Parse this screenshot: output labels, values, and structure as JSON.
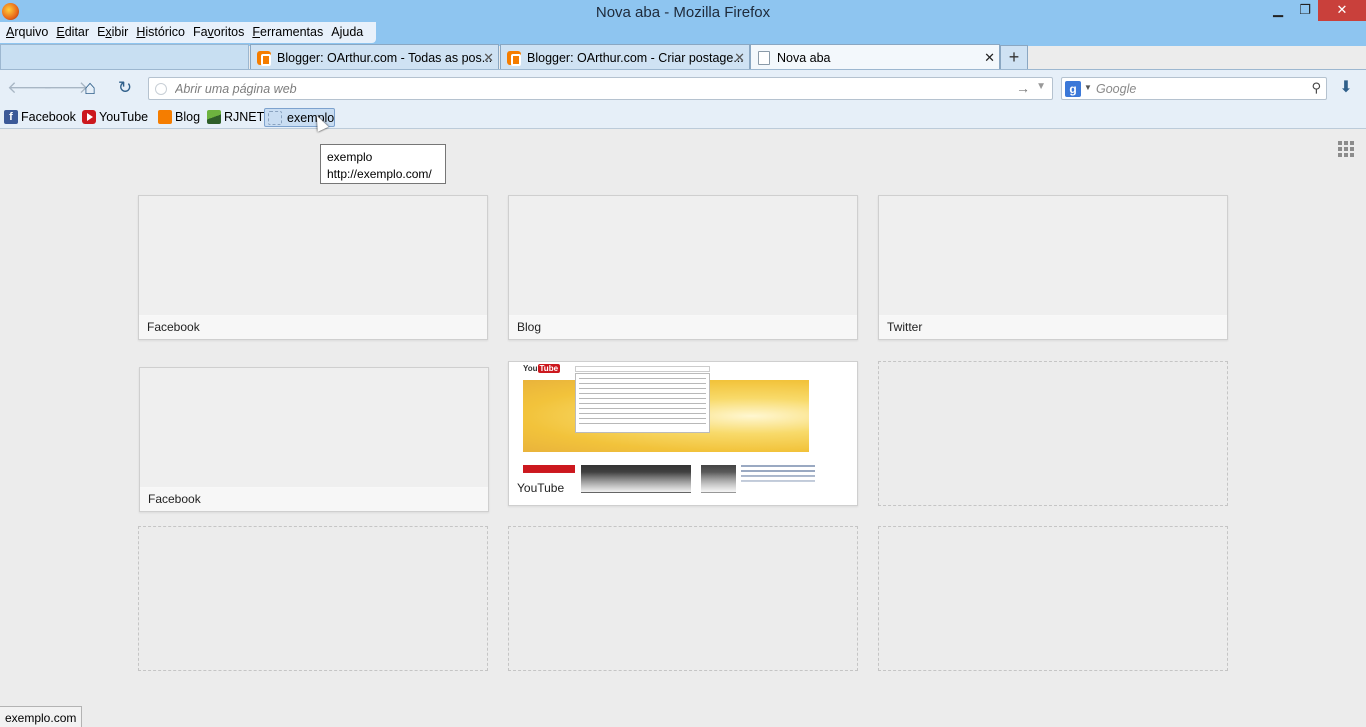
{
  "window": {
    "title": "Nova aba - Mozilla Firefox",
    "controls": {
      "minimize": "▁",
      "restore": "❐",
      "close": "✕"
    }
  },
  "menu": [
    {
      "label": "Arquivo",
      "accel": "A",
      "rest": "rquivo"
    },
    {
      "label": "Editar",
      "accel": "E",
      "rest": "ditar"
    },
    {
      "label": "Exibir",
      "accel": "x",
      "pre": "E",
      "rest": "ibir"
    },
    {
      "label": "Histórico",
      "accel": "H",
      "rest": "istórico"
    },
    {
      "label": "Favoritos",
      "accel": "v",
      "pre": "Fa",
      "rest": "oritos"
    },
    {
      "label": "Ferramentas",
      "accel": "F",
      "rest": "erramentas"
    },
    {
      "label": "Ajuda",
      "accel": "j",
      "pre": "A",
      "rest": "uda"
    }
  ],
  "tabs": [
    {
      "label": "Blogger: OArthur.com - Todas as pos...",
      "icon": "blogger-icon",
      "active": false
    },
    {
      "label": "Blogger: OArthur.com - Criar postage...",
      "icon": "blogger-icon",
      "active": false
    },
    {
      "label": "Nova aba",
      "icon": "blank-page-icon",
      "active": true
    }
  ],
  "tab_close_glyph": "✕",
  "new_tab_glyph": "+",
  "nav": {
    "back": "🡐",
    "forward": "🡒",
    "home": "⌂",
    "reload": "↻",
    "url_placeholder": "Abrir uma página web",
    "url_value": "",
    "go_glyph": "→",
    "dropdown_glyph": "▼",
    "search_engine": "g",
    "search_placeholder": "Google",
    "search_go": "⚲",
    "download_glyph": "⬇"
  },
  "bookmarks": [
    {
      "label": "Facebook",
      "icon": "facebook-icon"
    },
    {
      "label": "YouTube",
      "icon": "youtube-icon"
    },
    {
      "label": "Blog",
      "icon": "blogger-icon"
    },
    {
      "label": "RJNET",
      "icon": "rjnet-icon"
    },
    {
      "label": "exemplo",
      "icon": "blank-page-icon",
      "hovered": true
    }
  ],
  "tooltip": {
    "title": "exemplo",
    "url": "http://exemplo.com/"
  },
  "newtab_sites": [
    {
      "title": "Facebook",
      "thumbnail": "blank"
    },
    {
      "title": "Blog",
      "thumbnail": "blank"
    },
    {
      "title": "Twitter",
      "thumbnail": "blank"
    },
    {
      "title": "Facebook",
      "thumbnail": "blank"
    },
    {
      "title": "YouTube",
      "thumbnail": "youtube-page"
    },
    {
      "title": "",
      "thumbnail": "empty"
    },
    {
      "title": "",
      "thumbnail": "empty"
    },
    {
      "title": "",
      "thumbnail": "empty"
    },
    {
      "title": "",
      "thumbnail": "empty"
    }
  ],
  "status_bar": "exemplo.com"
}
